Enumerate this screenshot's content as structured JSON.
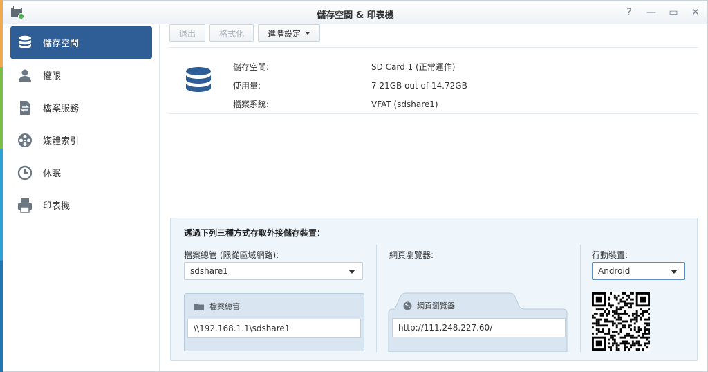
{
  "window": {
    "title": "儲存空間 & 印表機",
    "controls": [
      "help-icon",
      "minimize-icon",
      "maximize-icon",
      "close-icon"
    ]
  },
  "sidebar": {
    "items": [
      {
        "label": "儲存空間",
        "icon": "database-icon",
        "active": true
      },
      {
        "label": "權限",
        "icon": "user-icon",
        "active": false
      },
      {
        "label": "檔案服務",
        "icon": "file-service-icon",
        "active": false
      },
      {
        "label": "媒體索引",
        "icon": "film-reel-icon",
        "active": false
      },
      {
        "label": "休眠",
        "icon": "clock-icon",
        "active": false
      },
      {
        "label": "印表機",
        "icon": "printer-icon",
        "active": false
      }
    ]
  },
  "toolbar": {
    "eject_label": "退出",
    "format_label": "格式化",
    "advanced_label": "進階設定"
  },
  "storage_info": {
    "rows": [
      {
        "key": "儲存空間:",
        "value": "SD Card 1 (正常運作)"
      },
      {
        "key": "使用量:",
        "value": "7.21GB out of 14.72GB"
      },
      {
        "key": "檔案系統:",
        "value": "VFAT (sdshare1)"
      }
    ]
  },
  "access": {
    "title": "透過下列三種方式存取外接儲存裝置：",
    "file_manager": {
      "label": "檔案總管 (限從區域網路):",
      "selected": "sdshare1",
      "card_title": "檔案總管",
      "path": "\\\\192.168.1.1\\sdshare1"
    },
    "browser": {
      "label": "網頁瀏覽器:",
      "card_title": "網頁瀏覽器",
      "url": "http://111.248.227.60/"
    },
    "mobile": {
      "label": "行動裝置:",
      "selected": "Android"
    }
  },
  "colors": {
    "active_sidebar": "#2f5e96",
    "panel_bg": "#eef6fc",
    "db_icon": "#2f5e96"
  }
}
